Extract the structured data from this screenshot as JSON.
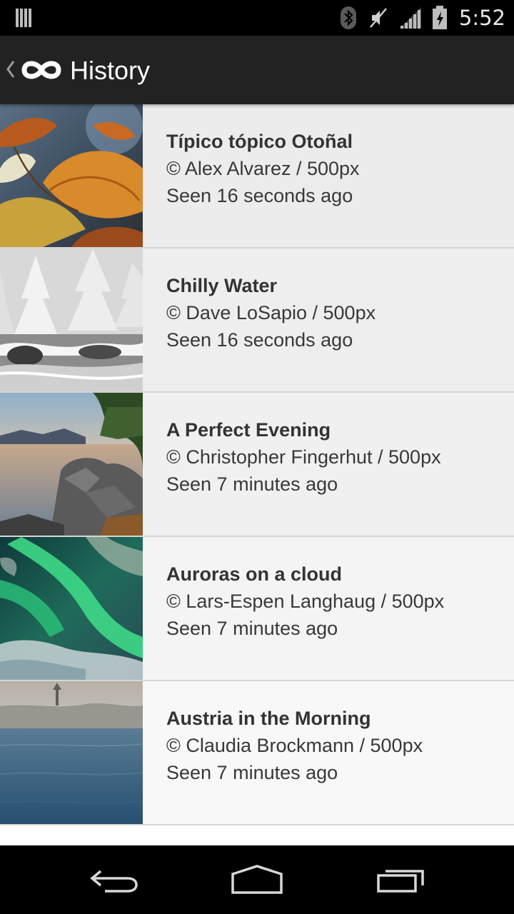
{
  "status_bar": {
    "time": "5:52",
    "icons": [
      "notification-bars-icon",
      "bluetooth-icon",
      "volume-muted-icon",
      "signal-icon",
      "battery-icon"
    ]
  },
  "action_bar": {
    "title": "History",
    "logo": "infinity-logo-icon",
    "up_icon": "back-chevron-icon"
  },
  "history": {
    "items": [
      {
        "title": "Típico tópico Otoñal",
        "credit": "© Alex Alvarez / 500px",
        "seen": "Seen 16 seconds ago"
      },
      {
        "title": "Chilly Water",
        "credit": "© Dave LoSapio / 500px",
        "seen": "Seen 16 seconds ago"
      },
      {
        "title": "A Perfect Evening",
        "credit": "© Christopher Fingerhut / 500px",
        "seen": "Seen 7 minutes ago"
      },
      {
        "title": "Auroras on a cloud",
        "credit": "© Lars-Espen Langhaug / 500px",
        "seen": "Seen 7 minutes ago"
      },
      {
        "title": "Austria in the Morning",
        "credit": "© Claudia Brockmann / 500px",
        "seen": "Seen 7 minutes ago"
      }
    ]
  },
  "nav_bar": {
    "buttons": [
      "back-nav-icon",
      "home-nav-icon",
      "recents-nav-icon"
    ]
  },
  "colors": {
    "status_bar_bg": "#000000",
    "action_bar_bg": "#222222",
    "list_bg": "#f2f2f2",
    "title_text": "#333333",
    "divider": "#d6d6d6"
  }
}
